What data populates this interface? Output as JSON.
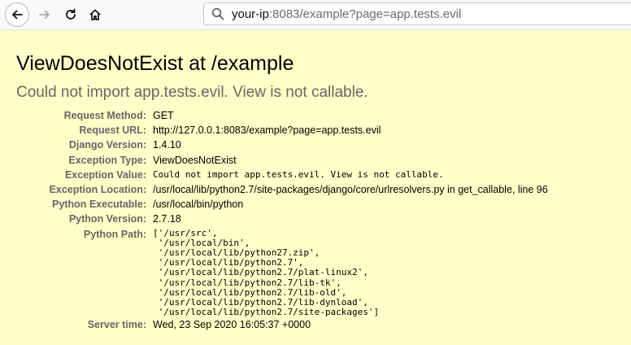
{
  "browser": {
    "url_host": "your-ip",
    "url_rest": ":8083/example?page=app.tests.evil"
  },
  "error": {
    "title": "ViewDoesNotExist at /example",
    "subtitle": "Could not import app.tests.evil. View is not callable."
  },
  "meta": {
    "request_method_label": "Request Method:",
    "request_method": "GET",
    "request_url_label": "Request URL:",
    "request_url": "http://127.0.0.1:8083/example?page=app.tests.evil",
    "django_version_label": "Django Version:",
    "django_version": "1.4.10",
    "exception_type_label": "Exception Type:",
    "exception_type": "ViewDoesNotExist",
    "exception_value_label": "Exception Value:",
    "exception_value": "Could not import app.tests.evil. View is not callable.",
    "exception_location_label": "Exception Location:",
    "exception_location": "/usr/local/lib/python2.7/site-packages/django/core/urlresolvers.py in get_callable, line 96",
    "python_executable_label": "Python Executable:",
    "python_executable": "/usr/local/bin/python",
    "python_version_label": "Python Version:",
    "python_version": "2.7.18",
    "python_path_label": "Python Path:",
    "python_path": "['/usr/src',\n '/usr/local/bin',\n '/usr/local/lib/python27.zip',\n '/usr/local/lib/python2.7',\n '/usr/local/lib/python2.7/plat-linux2',\n '/usr/local/lib/python2.7/lib-tk',\n '/usr/local/lib/python2.7/lib-old',\n '/usr/local/lib/python2.7/lib-dynload',\n '/usr/local/lib/python2.7/site-packages']",
    "server_time_label": "Server time:",
    "server_time": "Wed, 23 Sep 2020 16:05:37 +0000"
  }
}
